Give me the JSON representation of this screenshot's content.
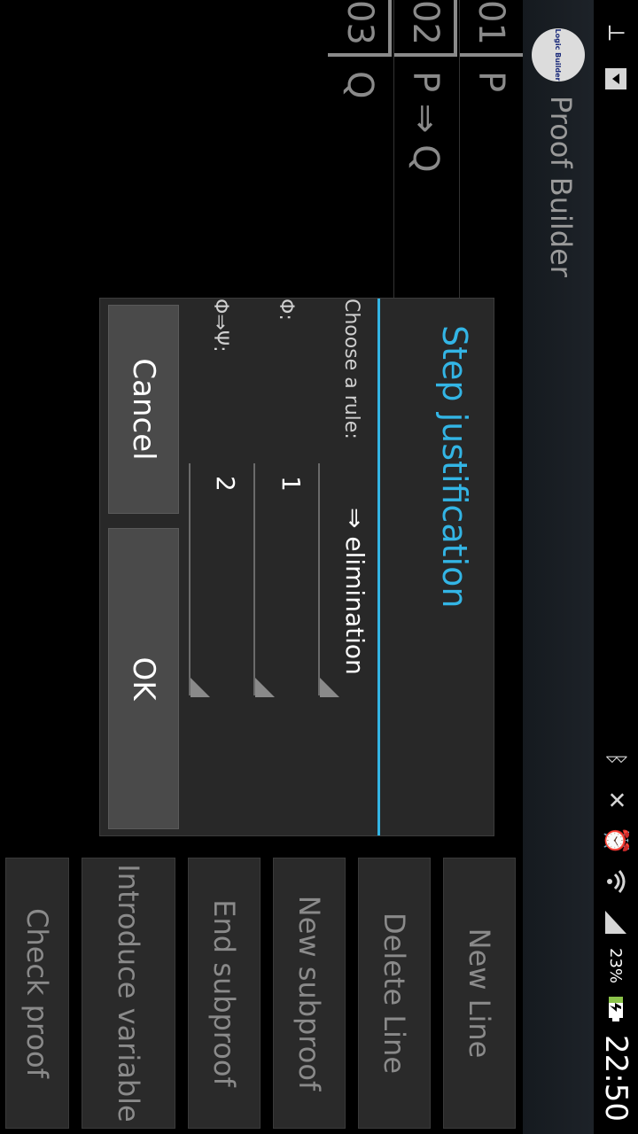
{
  "status_bar": {
    "time": "22:50",
    "battery_percent": "23%",
    "icons_left": [
      "usb-icon",
      "download-icon"
    ],
    "icons_right": [
      "bluetooth-icon",
      "mute-icon",
      "alarm-icon",
      "wifi-icon",
      "signal-icon",
      "battery-charging-icon"
    ]
  },
  "action_bar": {
    "logo_text": "Logic Builder",
    "title": "Proof Builder"
  },
  "proof": {
    "lines": [
      {
        "num": "01",
        "formula": "P"
      },
      {
        "num": "02",
        "formula": "P ⇒ Q"
      },
      {
        "num": "03",
        "formula": "Q"
      }
    ]
  },
  "side_buttons": {
    "new_line": "New Line",
    "delete_line": "Delete Line",
    "new_subproof": "New subproof",
    "end_subproof": "End subproof",
    "introduce_variable": "Introduce variable",
    "check_proof": "Check proof"
  },
  "dialog": {
    "title": "Step justification",
    "rule_label": "Choose a rule:",
    "rule_value": "⇒ elimination",
    "phi_label": "Φ:",
    "phi_value": "1",
    "phi_implies_psi_label": "Φ⇒Ψ:",
    "phi_implies_psi_value": "2",
    "cancel": "Cancel",
    "ok": "OK"
  },
  "colors": {
    "accent": "#33b5e5",
    "background": "#000000",
    "dialog_bg": "#282828"
  }
}
